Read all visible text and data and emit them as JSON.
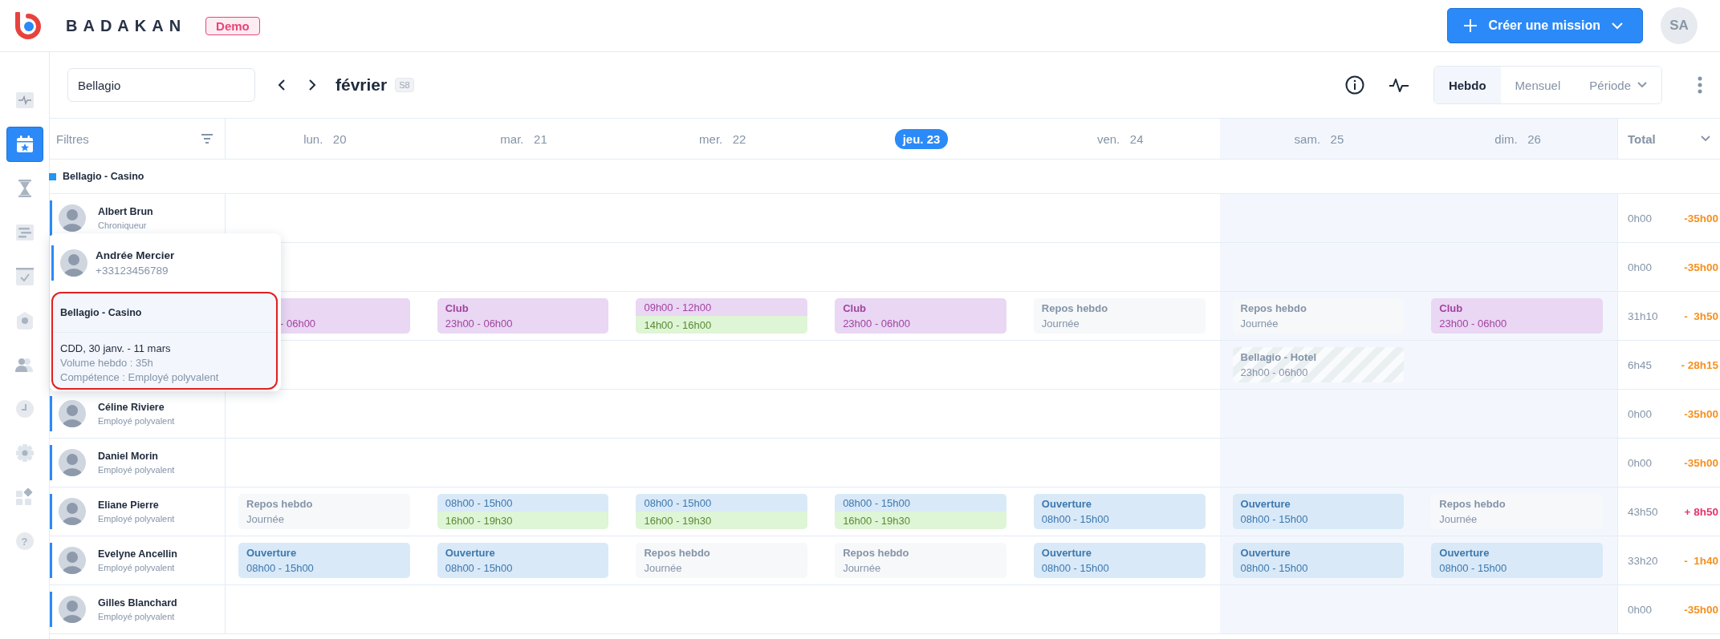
{
  "brand": {
    "name": "BADAKAN",
    "badge": "Demo"
  },
  "create_button": {
    "label": "Créer une mission"
  },
  "user": {
    "initials": "SA"
  },
  "sidebar": {
    "items": [
      {
        "kind": "activity",
        "selected": false
      },
      {
        "kind": "calendar",
        "selected": true
      },
      {
        "kind": "hourglass",
        "selected": false
      },
      {
        "kind": "gantt",
        "selected": false
      },
      {
        "kind": "tasks",
        "selected": false
      },
      {
        "kind": "location",
        "selected": false
      },
      {
        "kind": "users",
        "selected": false
      },
      {
        "kind": "clock",
        "selected": false
      },
      {
        "kind": "settings",
        "selected": false
      },
      {
        "kind": "apps",
        "selected": false
      },
      {
        "kind": "help",
        "selected": false,
        "glyph": "?"
      }
    ]
  },
  "toolbar": {
    "site_field": {
      "value": "Bellagio"
    },
    "month": "février",
    "week_badge": "S8",
    "views": [
      {
        "label": "Hebdo",
        "selected": true,
        "dropdown": false
      },
      {
        "label": "Mensuel",
        "selected": false,
        "dropdown": false
      },
      {
        "label": "Période",
        "selected": false,
        "dropdown": true
      }
    ]
  },
  "schedule": {
    "filter_label": "Filtres",
    "total_label": "Total",
    "days": [
      {
        "weekday": "lun.",
        "date": "20",
        "today": false,
        "weekend": false
      },
      {
        "weekday": "mar.",
        "date": "21",
        "today": false,
        "weekend": false
      },
      {
        "weekday": "mer.",
        "date": "22",
        "today": false,
        "weekend": false
      },
      {
        "weekday": "jeu.",
        "date": "23",
        "today": true,
        "weekend": false
      },
      {
        "weekday": "ven.",
        "date": "24",
        "today": false,
        "weekend": false
      },
      {
        "weekday": "sam.",
        "date": "25",
        "today": false,
        "weekend": true
      },
      {
        "weekday": "dim.",
        "date": "26",
        "today": false,
        "weekend": true
      }
    ],
    "group": {
      "name": "Bellagio - Casino",
      "color": "#2196f3"
    },
    "rows": [
      {
        "name": "Albert Brun",
        "role": "Chroniqueur",
        "cells": [
          {
            "kind": "empty"
          },
          {
            "kind": "empty"
          },
          {
            "kind": "empty"
          },
          {
            "kind": "empty"
          },
          {
            "kind": "empty"
          },
          {
            "kind": "empty"
          },
          {
            "kind": "empty"
          }
        ],
        "total": "0h00",
        "balance": "-35h00",
        "over_target": false
      },
      {
        "cells": [
          {
            "kind": "empty"
          },
          {
            "kind": "empty"
          },
          {
            "kind": "empty"
          },
          {
            "kind": "empty"
          },
          {
            "kind": "empty"
          },
          {
            "kind": "empty"
          },
          {
            "kind": "empty"
          }
        ],
        "total": "0h00",
        "balance": "-35h00",
        "over_target": false
      },
      {
        "cells": [
          {
            "kind": "club",
            "time": "- 06h00",
            "covered": true
          },
          {
            "kind": "club",
            "title": "Club",
            "time": "23h00 - 06h00"
          },
          {
            "kind": "split",
            "parts": [
              {
                "kind": "club",
                "time": "09h00 - 12h00"
              },
              {
                "kind": "green",
                "time": "14h00 - 16h00"
              }
            ]
          },
          {
            "kind": "club",
            "title": "Club",
            "time": "23h00 - 06h00"
          },
          {
            "kind": "rest",
            "title": "Repos hebdo",
            "time": "Journée"
          },
          {
            "kind": "rest",
            "title": "Repos hebdo",
            "time": "Journée"
          },
          {
            "kind": "club",
            "title": "Club",
            "time": "23h00 - 06h00"
          }
        ],
        "total": "31h10",
        "balance": "-  3h50",
        "over_target": false
      },
      {
        "cells": [
          {
            "kind": "empty"
          },
          {
            "kind": "empty"
          },
          {
            "kind": "empty"
          },
          {
            "kind": "empty"
          },
          {
            "kind": "empty"
          },
          {
            "kind": "other_site",
            "title": "Bellagio - Hotel",
            "time": "23h00 - 06h00"
          },
          {
            "kind": "empty"
          }
        ],
        "total": "6h45",
        "balance": "- 28h15",
        "over_target": false
      },
      {
        "name": "Céline Riviere",
        "role": "Employé polyvalent",
        "cells": [
          {
            "kind": "empty"
          },
          {
            "kind": "empty"
          },
          {
            "kind": "empty"
          },
          {
            "kind": "empty"
          },
          {
            "kind": "empty"
          },
          {
            "kind": "empty"
          },
          {
            "kind": "empty"
          }
        ],
        "total": "0h00",
        "balance": "-35h00",
        "over_target": false
      },
      {
        "name": "Daniel Morin",
        "role": "Employé polyvalent",
        "cells": [
          {
            "kind": "empty"
          },
          {
            "kind": "empty"
          },
          {
            "kind": "empty"
          },
          {
            "kind": "empty"
          },
          {
            "kind": "empty"
          },
          {
            "kind": "empty"
          },
          {
            "kind": "empty"
          }
        ],
        "total": "0h00",
        "balance": "-35h00",
        "over_target": false
      },
      {
        "name": "Eliane Pierre",
        "role": "Employé polyvalent",
        "cells": [
          {
            "kind": "rest",
            "title": "Repos hebdo",
            "time": "Journée"
          },
          {
            "kind": "split",
            "parts": [
              {
                "kind": "opening",
                "time": "08h00 - 15h00"
              },
              {
                "kind": "green",
                "time": "16h00 - 19h30"
              }
            ]
          },
          {
            "kind": "split",
            "parts": [
              {
                "kind": "opening",
                "time": "08h00 - 15h00"
              },
              {
                "kind": "green",
                "time": "16h00 - 19h30"
              }
            ]
          },
          {
            "kind": "split",
            "parts": [
              {
                "kind": "opening",
                "time": "08h00 - 15h00"
              },
              {
                "kind": "green",
                "time": "16h00 - 19h30"
              }
            ]
          },
          {
            "kind": "opening",
            "title": "Ouverture",
            "time": "08h00 - 15h00"
          },
          {
            "kind": "opening",
            "title": "Ouverture",
            "time": "08h00 - 15h00"
          },
          {
            "kind": "rest",
            "title": "Repos hebdo",
            "time": "Journée"
          }
        ],
        "total": "43h50",
        "balance": "+ 8h50",
        "over_target": true
      },
      {
        "name": "Evelyne Ancellin",
        "role": "Employé polyvalent",
        "cells": [
          {
            "kind": "opening",
            "title": "Ouverture",
            "time": "08h00 - 15h00"
          },
          {
            "kind": "opening",
            "title": "Ouverture",
            "time": "08h00 - 15h00"
          },
          {
            "kind": "rest",
            "title": "Repos hebdo",
            "time": "Journée"
          },
          {
            "kind": "rest",
            "title": "Repos hebdo",
            "time": "Journée"
          },
          {
            "kind": "opening",
            "title": "Ouverture",
            "time": "08h00 - 15h00"
          },
          {
            "kind": "opening",
            "title": "Ouverture",
            "time": "08h00 - 15h00"
          },
          {
            "kind": "opening",
            "title": "Ouverture",
            "time": "08h00 - 15h00"
          }
        ],
        "total": "33h20",
        "balance": "-  1h40",
        "over_target": false
      },
      {
        "name": "Gilles Blanchard",
        "role": "Employé polyvalent",
        "cells": [
          {
            "kind": "empty"
          },
          {
            "kind": "empty"
          },
          {
            "kind": "empty"
          },
          {
            "kind": "empty"
          },
          {
            "kind": "empty"
          },
          {
            "kind": "empty"
          },
          {
            "kind": "empty"
          }
        ],
        "total": "0h00",
        "balance": "-35h00",
        "over_target": false
      }
    ]
  },
  "hover_card": {
    "person": {
      "name": "Andrée Mercier",
      "phone": "+33123456789"
    },
    "contract": {
      "site": "Bellagio - Casino",
      "title": "CDD, 30 janv. - 11 mars",
      "details": [
        "Volume hebdo : 35h",
        "Compétence : Employé polyvalent"
      ]
    }
  }
}
